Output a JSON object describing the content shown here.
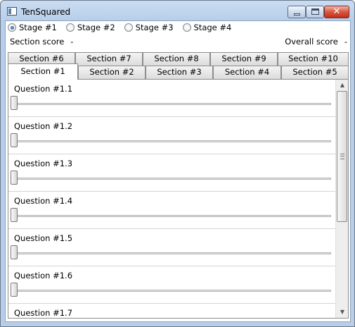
{
  "window": {
    "title": "TenSquared"
  },
  "title_buttons": {
    "close_glyph": "✕"
  },
  "stages": [
    {
      "label": "Stage #1",
      "selected": true
    },
    {
      "label": "Stage #2",
      "selected": false
    },
    {
      "label": "Stage #3",
      "selected": false
    },
    {
      "label": "Stage #4",
      "selected": false
    }
  ],
  "scores": {
    "section_label": "Section score",
    "section_value": "-",
    "overall_label": "Overall score",
    "overall_value": "-"
  },
  "tabs_back": [
    "Section #6",
    "Section #7",
    "Section #8",
    "Section #9",
    "Section #10"
  ],
  "tabs_front": [
    "Section #1",
    "Section #2",
    "Section #3",
    "Section #4",
    "Section #5"
  ],
  "selected_tab": "Section #1",
  "questions": [
    {
      "label": "Question #1.1",
      "value": 0
    },
    {
      "label": "Question #1.2",
      "value": 0
    },
    {
      "label": "Question #1.3",
      "value": 0
    },
    {
      "label": "Question #1.4",
      "value": 0
    },
    {
      "label": "Question #1.5",
      "value": 0
    },
    {
      "label": "Question #1.6",
      "value": 0
    },
    {
      "label": "Question #1.7",
      "value": 0
    }
  ],
  "scrollbar": {
    "up_glyph": "▲",
    "down_glyph": "▼"
  }
}
